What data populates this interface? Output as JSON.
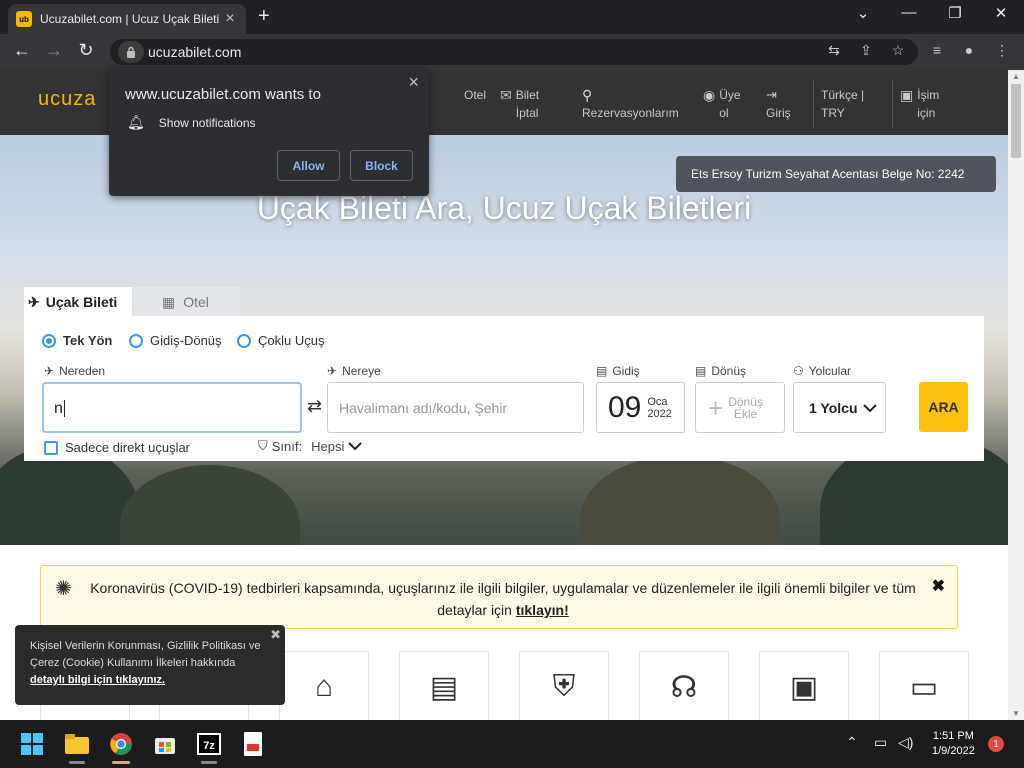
{
  "browser": {
    "tab_title": "Ucuzabilet.com | Ucuz Uçak Bileti",
    "favicon_text": "ub",
    "new_tab": "+",
    "minimize": "⌄",
    "address": "ucuzabilet.com"
  },
  "header": {
    "logo": "ucuza",
    "nav": [
      {
        "line1": "Otel",
        "line2": ""
      },
      {
        "line1": "Bilet",
        "line2": "İptal"
      },
      {
        "line1": "",
        "line2": "Rezervasyonlarım"
      },
      {
        "line1": "Üye",
        "line2": "ol"
      },
      {
        "line1": "",
        "line2": "Giriş"
      },
      {
        "line1": "Türkçe |",
        "line2": "TRY"
      },
      {
        "line1": "İşim",
        "line2": "için"
      }
    ]
  },
  "notification": {
    "title": "www.ucuzabilet.com wants to",
    "message": "Show notifications",
    "allow": "Allow",
    "block": "Block"
  },
  "hero": {
    "title": "Uçak Bileti Ara, Ucuz Uçak Biletleri",
    "license": "Ets Ersoy Turizm Seyahat Acentası Belge No: 2242"
  },
  "search": {
    "tabs": [
      "Uçak Bileti",
      "Otel"
    ],
    "trip_types": [
      "Tek Yön",
      "Gidiş-Dönüş",
      "Çoklu Uçuş"
    ],
    "from_label": "Nereden",
    "from_value": "n",
    "to_label": "Nereye",
    "to_placeholder": "Havalimanı adı/kodu, Şehir",
    "depart_label": "Gidiş",
    "depart_day": "09",
    "depart_month": "Oca",
    "depart_year": "2022",
    "return_label": "Dönüş",
    "return_line1": "Dönüş",
    "return_line2": "Ekle",
    "pax_label": "Yolcular",
    "pax_value": "1 Yolcu",
    "search_button": "ARA",
    "direct_flights": "Sadece direkt uçuşlar",
    "class_label": "Sınıf:",
    "class_value": "Hepsi"
  },
  "covid": {
    "text": "Koronavirüs (COVID-19) tedbirleri kapsamında, uçuşlarınız ile ilgili bilgiler, uygulamalar ve düzenlemeler ile ilgili önemli bilgiler ve tüm detaylar için ",
    "link": "tıklayın!"
  },
  "cookie": {
    "text": "Kişisel Verilerin Korunması, Gizlilik Politikası ve Çerez (Cookie) Kullanımı İlkeleri hakkında ",
    "link": "detaylı bilgi için tıklayınız."
  },
  "taskbar": {
    "time": "1:51 PM",
    "date": "1/9/2022",
    "notification_count": "1"
  },
  "colors": {
    "accent": "#f9c10e",
    "radio_blue": "#3d9ae8"
  }
}
